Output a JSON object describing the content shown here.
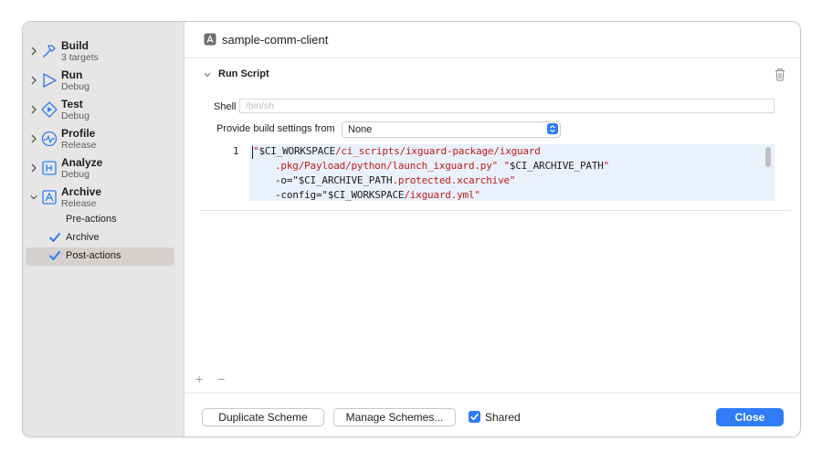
{
  "sidebar": {
    "items": [
      {
        "title": "Build",
        "subtitle": "3 targets",
        "icon": "hammer-icon"
      },
      {
        "title": "Run",
        "subtitle": "Debug",
        "icon": "play-icon"
      },
      {
        "title": "Test",
        "subtitle": "Debug",
        "icon": "test-diamond-icon"
      },
      {
        "title": "Profile",
        "subtitle": "Release",
        "icon": "gauge-icon"
      },
      {
        "title": "Analyze",
        "subtitle": "Debug",
        "icon": "analyze-icon"
      },
      {
        "title": "Archive",
        "subtitle": "Release",
        "icon": "archive-icon"
      }
    ],
    "archive_subitems": [
      {
        "label": "Pre-actions",
        "checked": false,
        "selected": false
      },
      {
        "label": "Archive",
        "checked": true,
        "selected": false
      },
      {
        "label": "Post-actions",
        "checked": true,
        "selected": true
      }
    ]
  },
  "header": {
    "target_name": "sample-comm-client"
  },
  "phase": {
    "title": "Run Script",
    "shell_label": "Shell",
    "shell_placeholder": "/bin/sh",
    "provide_label": "Provide build settings from",
    "provide_value": "None",
    "line_number": "1",
    "script_lines": [
      [
        {
          "t": "\"",
          "k": "q"
        },
        {
          "t": "$CI_WORKSPACE",
          "k": "v"
        },
        {
          "t": "/ci_scripts/ixguard-package/ixguard",
          "k": "q"
        }
      ],
      [
        {
          "t": ".pkg/Payload/python/launch_ixguard.py\" \"",
          "k": "q"
        },
        {
          "t": "$CI_ARCHIVE_PATH",
          "k": "v"
        },
        {
          "t": "\"",
          "k": "q"
        }
      ],
      [
        {
          "t": "-o=\"",
          "k": "v"
        },
        {
          "t": "$CI_ARCHIVE_PATH",
          "k": "v"
        },
        {
          "t": ".protected.xcarchive\"",
          "k": "q"
        }
      ],
      [
        {
          "t": "-config=\"",
          "k": "v"
        },
        {
          "t": "$CI_WORKSPACE",
          "k": "v"
        },
        {
          "t": "/ixguard.yml\"",
          "k": "q"
        }
      ]
    ]
  },
  "actions": {
    "add": "+",
    "remove": "−"
  },
  "footer": {
    "duplicate": "Duplicate Scheme",
    "manage": "Manage Schemes...",
    "shared": "Shared",
    "shared_checked": true,
    "close": "Close"
  },
  "colors": {
    "accent": "#2f7cf6",
    "sidebar_bg": "#e8e6e4",
    "code_bg": "#e9f1fd",
    "string": "#c41a16"
  }
}
